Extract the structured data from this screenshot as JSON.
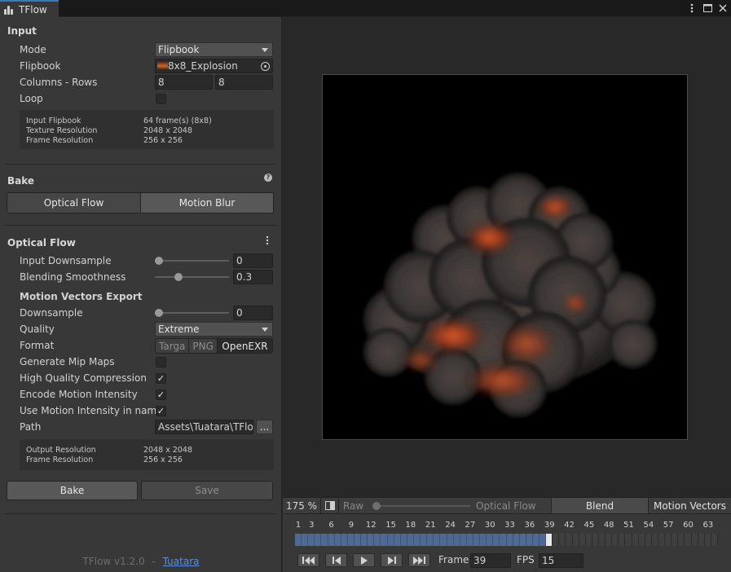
{
  "window": {
    "tab_title": "TFlow"
  },
  "input": {
    "section_title": "Input",
    "mode_label": "Mode",
    "mode_value": "Flipbook",
    "flipbook_label": "Flipbook",
    "flipbook_value": "8x8_Explosion",
    "colrows_label": "Columns - Rows",
    "columns_value": "8",
    "rows_value": "8",
    "loop_label": "Loop",
    "loop_checked": false,
    "info": [
      {
        "key": "Input Flipbook",
        "value": "64 frame(s) (8x8)"
      },
      {
        "key": "Texture Resolution",
        "value": "2048 x 2048"
      },
      {
        "key": "Frame Resolution",
        "value": "256 x 256"
      }
    ]
  },
  "bake": {
    "section_title": "Bake",
    "tabs": [
      "Optical Flow",
      "Motion Blur"
    ],
    "selected_tab": "Optical Flow"
  },
  "optical_flow": {
    "section_title": "Optical Flow",
    "input_downsample_label": "Input Downsample",
    "input_downsample_value": "0",
    "input_downsample_fraction": 0.0,
    "blending_label": "Blending Smoothness",
    "blending_value": "0.3",
    "blending_fraction": 0.3,
    "export_title": "Motion Vectors Export",
    "downsample_label": "Downsample",
    "downsample_value": "0",
    "downsample_fraction": 0.0,
    "quality_label": "Quality",
    "quality_value": "Extreme",
    "format_label": "Format",
    "formats": [
      "Targa",
      "PNG",
      "OpenEXR"
    ],
    "selected_format": "OpenEXR",
    "mips_label": "Generate Mip Maps",
    "mips_checked": false,
    "hq_label": "High Quality Compression",
    "hq_checked": true,
    "encode_label": "Encode Motion Intensity",
    "encode_checked": true,
    "use_intensity_label": "Use Motion Intensity in name",
    "use_intensity_checked": true,
    "path_label": "Path",
    "path_value": "Assets\\Tuatara\\TFlo",
    "browse_label": "...",
    "info": [
      {
        "key": "Output Resolution",
        "value": "2048 x 2048"
      },
      {
        "key": "Frame Resolution",
        "value": "256 x 256"
      }
    ],
    "bake_button": "Bake",
    "save_button": "Save"
  },
  "footer": {
    "version": "TFlow v1.2.0",
    "separator": "-",
    "link": "Tuatara"
  },
  "preview_toolbar": {
    "zoom": "175 %",
    "raw_label": "Raw",
    "optical_flow_label": "Optical Flow",
    "blend_label": "Blend",
    "motion_vectors_label": "Motion Vectors"
  },
  "timeline": {
    "ticks": [
      "1",
      "3",
      "6",
      "9",
      "12",
      "15",
      "18",
      "21",
      "24",
      "27",
      "30",
      "33",
      "36",
      "39",
      "42",
      "45",
      "48",
      "51",
      "54",
      "57",
      "60",
      "63"
    ],
    "total_frames": 64,
    "current_frame": 39,
    "frame_label": "Frame",
    "frame_value": "39",
    "fps_label": "FPS",
    "fps_value": "15"
  },
  "colors": {
    "accent": "#3a79bb",
    "timeline_fill": "#4e6a93",
    "link": "#5a8fd8"
  }
}
